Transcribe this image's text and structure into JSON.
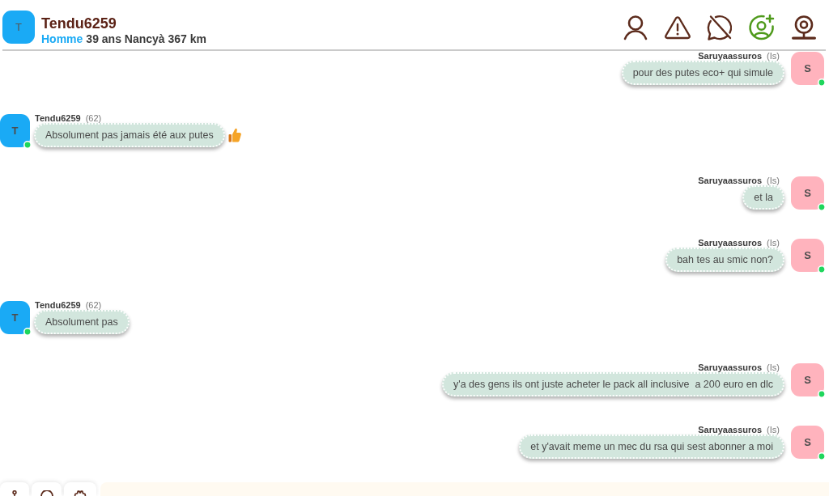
{
  "header": {
    "avatar": {
      "letter": "T",
      "color": "#1aaaf5"
    },
    "name": "Tendu6259",
    "gender": "Homme",
    "details": "39 ans Nancyà 367 km"
  },
  "messages": [
    {
      "kind": "outgoing",
      "author": "Saruyaassuros",
      "tag": "(Is)",
      "text": "pour des putes eco+ qui simule",
      "avatar": {
        "letter": "S",
        "color": "#ffb3bd",
        "online": true
      },
      "liked": false
    },
    {
      "kind": "incoming",
      "author": "Tendu6259",
      "tag": "(62)",
      "text": "Absolument pas jamais été aux putes",
      "avatar": {
        "letter": "T",
        "color": "#1aaaf5",
        "online": true
      },
      "liked": true
    },
    {
      "kind": "outgoing",
      "author": "Saruyaassuros",
      "tag": "(Is)",
      "text": "et la",
      "avatar": {
        "letter": "S",
        "color": "#ffb3bd",
        "online": true
      },
      "liked": false
    },
    {
      "kind": "outgoing",
      "author": "Saruyaassuros",
      "tag": "(Is)",
      "text": "bah tes au smic non?",
      "avatar": {
        "letter": "S",
        "color": "#ffb3bd",
        "online": true
      },
      "liked": false
    },
    {
      "kind": "incoming",
      "author": "Tendu6259",
      "tag": "(62)",
      "text": "Absolument pas",
      "avatar": {
        "letter": "T",
        "color": "#1aaaf5",
        "online": true
      },
      "liked": false
    },
    {
      "kind": "outgoing",
      "author": "Saruyaassuros",
      "tag": "(Is)",
      "text": "y'a des gens ils ont juste acheter le pack all inclusive  a 200 euro en dlc",
      "avatar": {
        "letter": "S",
        "color": "#ffb3bd",
        "online": true
      },
      "liked": false
    },
    {
      "kind": "outgoing",
      "author": "Saruyaassuros",
      "tag": "(Is)",
      "text": "et y'avait meme un mec du rsa qui sest abonner a moi",
      "avatar": {
        "letter": "S",
        "color": "#ffb3bd",
        "online": true
      },
      "liked": false
    }
  ]
}
